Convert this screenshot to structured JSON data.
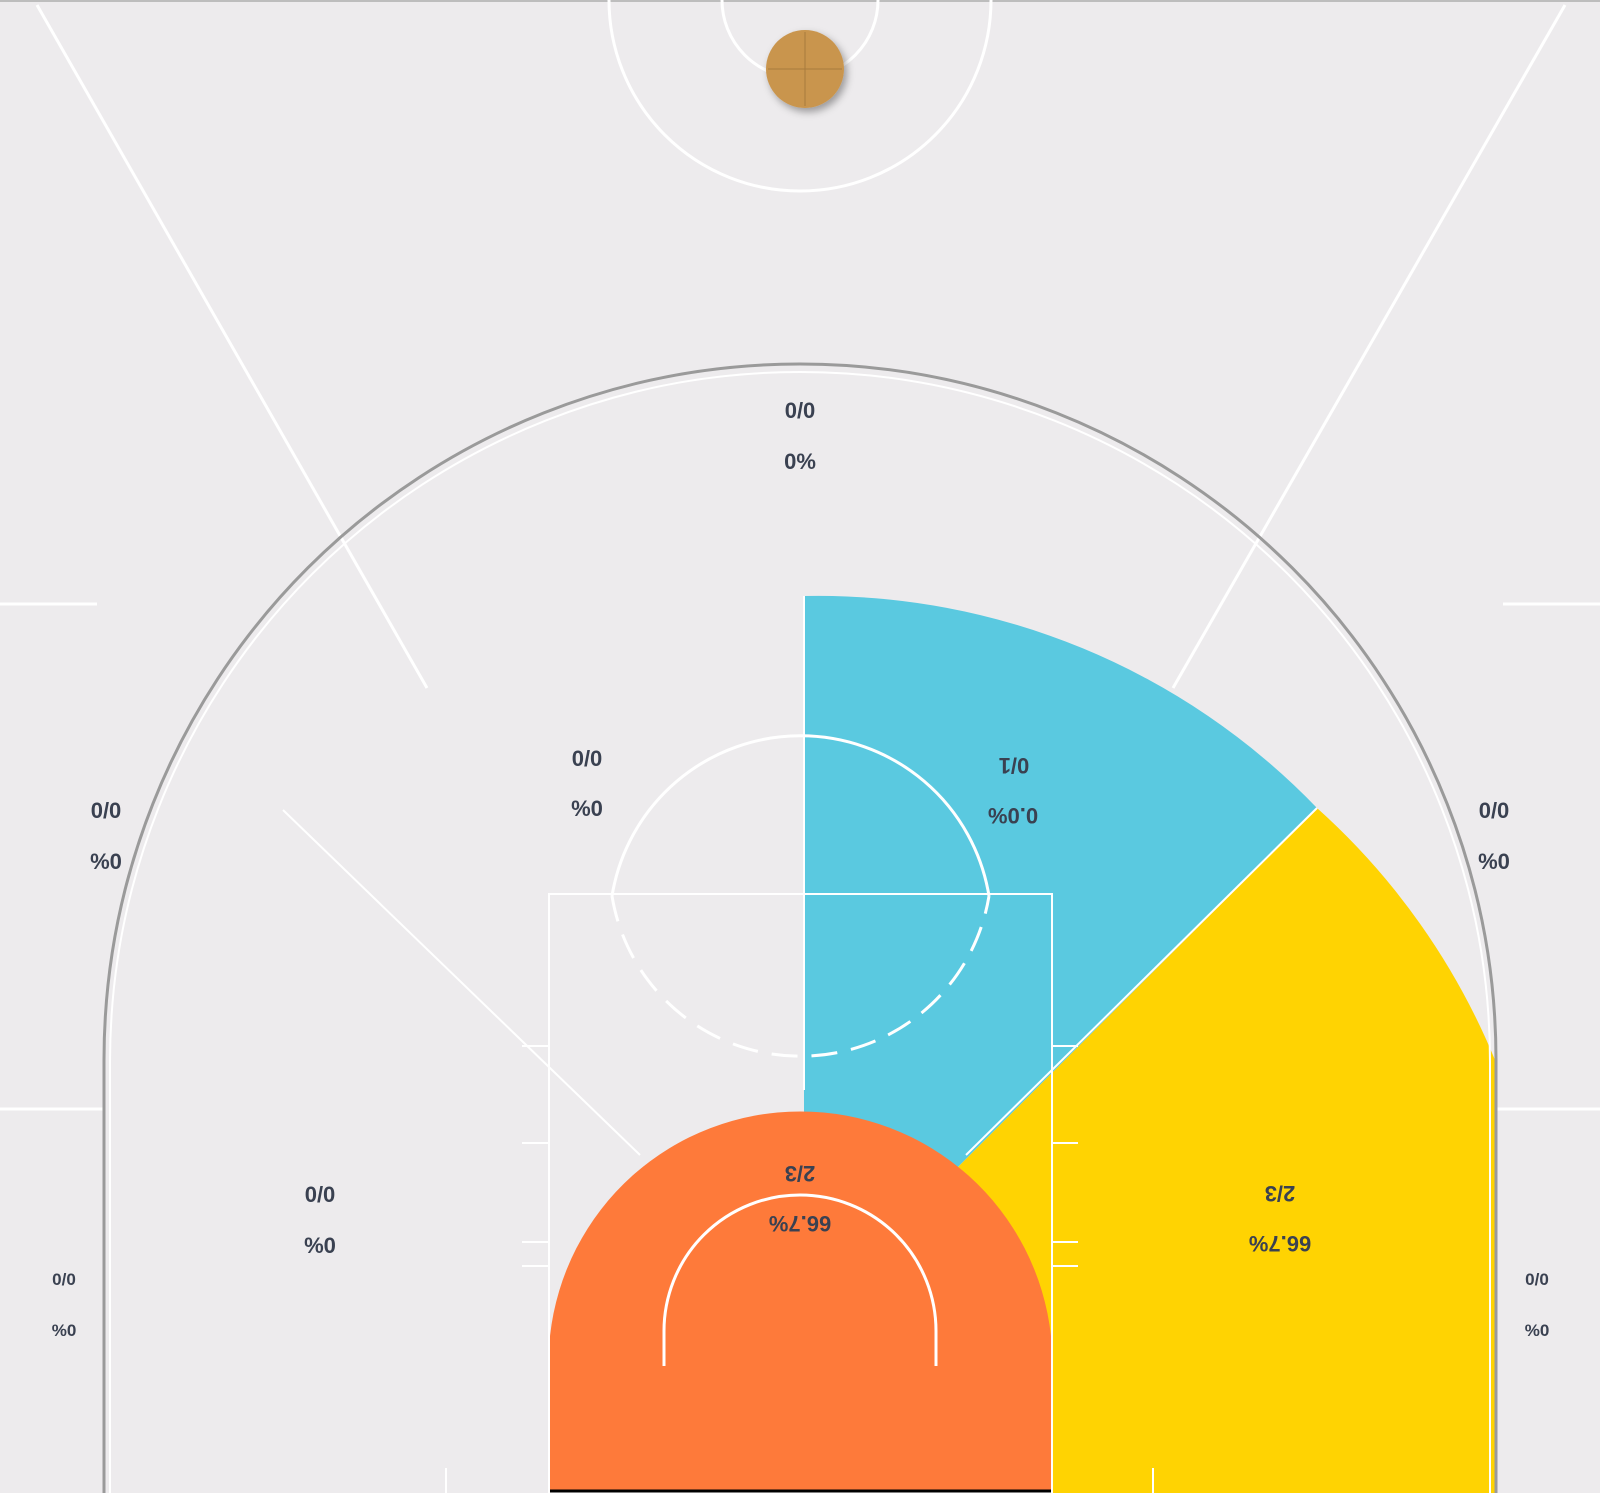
{
  "court": {
    "background_color": "#edebed",
    "line_color": "#ffffff",
    "outline_color": "#9a9a9a",
    "ball_icon": "basketball-icon",
    "ball_color": "#c9954d"
  },
  "zones": {
    "deep_three": {
      "made_attempts": "0/0",
      "percent": "0%",
      "color": "#edebed"
    },
    "left_wing_three": {
      "made_attempts": "0/0",
      "percent": "%0",
      "color": "#edebed"
    },
    "right_wing_three": {
      "made_attempts": "0/0",
      "percent": "%0",
      "color": "#edebed"
    },
    "left_corner_three": {
      "made_attempts": "0/0",
      "percent": "%0",
      "color": "#edebed"
    },
    "right_corner_three": {
      "made_attempts": "0/0",
      "percent": "%0",
      "color": "#edebed"
    },
    "left_top_midrange": {
      "made_attempts": "0/0",
      "percent": "%0",
      "color": "#edebed"
    },
    "right_top_midrange": {
      "made_attempts": "0/1",
      "percent": "0.0%",
      "color": "#5ac9e0"
    },
    "left_baseline_midrange": {
      "made_attempts": "0/0",
      "percent": "%0",
      "color": "#edebed"
    },
    "right_baseline_midrange": {
      "made_attempts": "2/3",
      "percent": "66.7%",
      "color": "#ffd302"
    },
    "restricted_area": {
      "made_attempts": "2/3",
      "percent": "66.7%",
      "color": "#fe7a3a"
    }
  }
}
